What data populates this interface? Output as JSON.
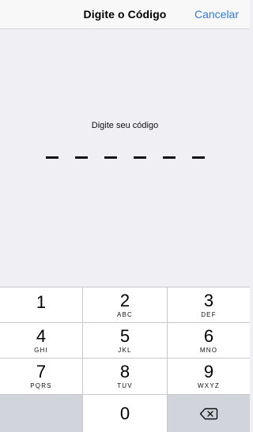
{
  "navbar": {
    "title": "Digite o Código",
    "cancel_label": "Cancelar"
  },
  "content": {
    "prompt": "Digite seu código",
    "code_length": 6,
    "entered_digits": 0
  },
  "keypad": {
    "keys": [
      {
        "digit": "1",
        "letters": ""
      },
      {
        "digit": "2",
        "letters": "ABC"
      },
      {
        "digit": "3",
        "letters": "DEF"
      },
      {
        "digit": "4",
        "letters": "GHI"
      },
      {
        "digit": "5",
        "letters": "JKL"
      },
      {
        "digit": "6",
        "letters": "MNO"
      },
      {
        "digit": "7",
        "letters": "PQRS"
      },
      {
        "digit": "8",
        "letters": "TUV"
      },
      {
        "digit": "9",
        "letters": "WXYZ"
      },
      {
        "digit": "0",
        "letters": ""
      }
    ],
    "backspace_icon": "delete-left-icon"
  },
  "colors": {
    "accent": "#2f7bd9",
    "background": "#efeff4",
    "keypad_bg": "#c8c8cd"
  }
}
